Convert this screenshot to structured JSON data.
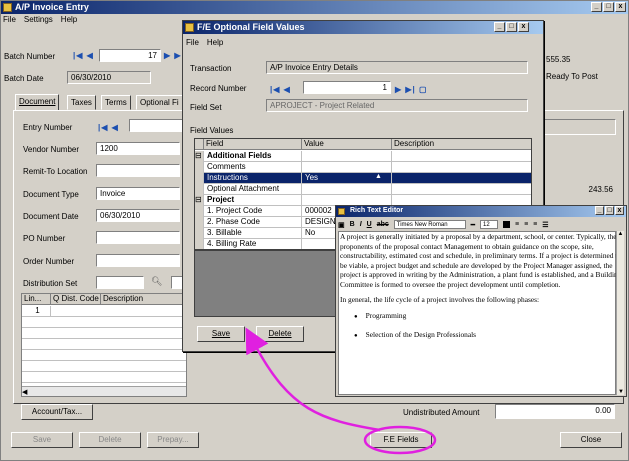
{
  "main": {
    "title": "A/P Invoice Entry",
    "menu": [
      "File",
      "Settings",
      "Help"
    ],
    "batch_number_label": "Batch Number",
    "batch_number_value": "17",
    "batch_date_label": "Batch Date",
    "batch_date_value": "06/30/2010",
    "batch_total": "555.35",
    "batch_status": "Ready To Post",
    "tabs": [
      "Document",
      "Taxes",
      "Terms",
      "Optional Fi"
    ],
    "entry_number_label": "Entry Number",
    "vendor_number_label": "Vendor Number",
    "vendor_number_value": "1200",
    "remit_to_label": "Remit-To Location",
    "doc_type_label": "Document Type",
    "doc_type_value": "Invoice",
    "doc_date_label": "Document Date",
    "doc_date_value": "06/30/2010",
    "po_number_label": "PO Number",
    "order_number_label": "Order Number",
    "dist_set_label": "Distribution Set",
    "doc_total": "243.56",
    "grid_headers": [
      "Lin...",
      "Dist. Code",
      "Description"
    ],
    "grid_rows": [
      "1"
    ],
    "account_tax_button": "Account/Tax...",
    "undistributed_label": "Undistributed Amount",
    "undistributed_value": "0.00",
    "save_button": "Save",
    "delete_button": "Delete",
    "prepay_button": "Prepay...",
    "fields_button": "F.E Fields",
    "close_button": "Close"
  },
  "optional": {
    "title": "F/E Optional Field Values",
    "menu": [
      "File",
      "Help"
    ],
    "transaction_label": "Transaction",
    "transaction_value": "A/P Invoice Entry Details",
    "record_number_label": "Record Number",
    "record_number_value": "1",
    "field_set_label": "Field Set",
    "field_set_value": "APROJECT - Project Related",
    "field_values_label": "Field Values",
    "headers": [
      "Field",
      "Value",
      "Description"
    ],
    "rows": [
      {
        "field": "Additional Fields",
        "value": "",
        "group": true
      },
      {
        "field": "Comments",
        "value": ""
      },
      {
        "field": "Instructions",
        "value": "Yes",
        "selected": true
      },
      {
        "field": "Optional Attachment",
        "value": ""
      },
      {
        "field": "Project",
        "value": "",
        "group": true
      },
      {
        "field": "1. Project Code",
        "value": "000002"
      },
      {
        "field": "2. Phase Code",
        "value": "DESIGN"
      },
      {
        "field": "3. Billable",
        "value": "No"
      },
      {
        "field": "4. Billing Rate",
        "value": ""
      }
    ],
    "save_button": "Save",
    "delete_button": "Delete"
  },
  "rte": {
    "title": "Rich Text Editor",
    "font_name": "Times New Roman",
    "font_size": "12",
    "paragraphs": [
      "A project is generally initiated by a proposal by a department, school, or center. Typically, the proponents of the proposal contact Management to obtain guidance on the scope, site, constructability, estimated cost and schedule, in preliminary terms. If a project is determined to be viable, a project budget and schedule are developed by the Project Manager assigned, the project is approved in writing by the Administration, a plant fund is established, and a Building Committee is formed to oversee the project development until completion.",
      "In general, the life cycle of a project involves the following phases:"
    ],
    "bullets": [
      "Programming",
      "Selection of the Design Professionals"
    ]
  },
  "colors": {
    "title_blue": "#0a246a",
    "selection": "#0a246a",
    "annotation": "#e020e0",
    "nav_blue": "#1c4fb0"
  }
}
